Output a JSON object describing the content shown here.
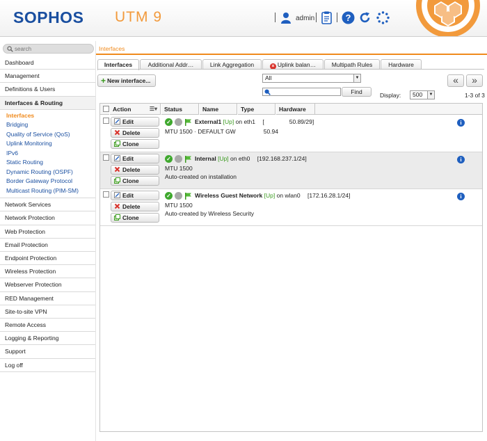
{
  "header": {
    "logo": "SOPHOS",
    "product": "UTM 9",
    "user": "admin",
    "accent_color": "#f29a3c",
    "brand_color": "#1a4fa0"
  },
  "sidebar": {
    "search_placeholder": "search",
    "items_top": [
      "Dashboard",
      "Management",
      "Definitions & Users"
    ],
    "active_group": "Interfaces & Routing",
    "sub_items": [
      "Interfaces",
      "Bridging",
      "Quality of Service (QoS)",
      "Uplink Monitoring",
      "IPv6",
      "Static Routing",
      "Dynamic Routing (OSPF)",
      "Border Gateway Protocol",
      "Multicast Routing (PIM-SM)"
    ],
    "items_bottom": [
      "Network Services",
      "Network Protection",
      "Web Protection",
      "Email Protection",
      "Endpoint Protection",
      "Wireless Protection",
      "Webserver Protection",
      "RED Management",
      "Site-to-site VPN",
      "Remote Access",
      "Logging & Reporting",
      "Support",
      "Log off"
    ]
  },
  "breadcrumb": "Interfaces",
  "tabs": [
    "Interfaces",
    "Additional Addr…",
    "Link Aggregation",
    "Uplink balan…",
    "Multipath Rules",
    "Hardware"
  ],
  "toolbar": {
    "new_button": "New interface...",
    "filter_value": "All",
    "find_button": "Find",
    "display_label": "Display:",
    "display_value": "500",
    "prev_icon": "«",
    "next_icon": "»",
    "range": "1-3 of 3"
  },
  "table": {
    "columns": [
      "Action",
      "Status",
      "Name",
      "Type",
      "Hardware"
    ],
    "buttons": {
      "edit": "Edit",
      "delete": "Delete",
      "clone": "Clone"
    },
    "rows": [
      {
        "name": "External1",
        "state": "[Up]",
        "on": "on eth1",
        "address": "[",
        "address_end": "50.89/29]",
        "line2_left": "MTU 1500 · DEFAULT GW",
        "line2_right": "50.94",
        "line3": ""
      },
      {
        "name": "Internal",
        "state": "[Up]",
        "on": "on eth0",
        "address": "[192.168.237.1/24]",
        "address_end": "",
        "line2_left": "MTU 1500",
        "line2_right": "",
        "line3": "Auto-created on installation"
      },
      {
        "name": "Wireless Guest Network",
        "state": "[Up]",
        "on": "on wlan0",
        "address": "[172.16.28.1/24]",
        "address_end": "",
        "line2_left": "MTU 1500",
        "line2_right": "",
        "line3": "Auto-created by Wireless Security"
      }
    ]
  }
}
